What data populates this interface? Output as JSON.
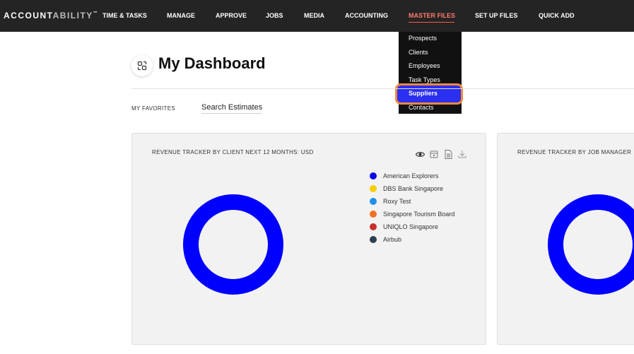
{
  "app": {
    "logo_bold": "ACCOUNT",
    "logo_light": "ABILITY",
    "logo_tm": "™"
  },
  "nav": {
    "items": [
      {
        "label": "TIME & TASKS"
      },
      {
        "label": "MANAGE"
      },
      {
        "label": "APPROVE"
      },
      {
        "label": "JOBS"
      },
      {
        "label": "MEDIA"
      },
      {
        "label": "ACCOUNTING"
      },
      {
        "label": "MASTER FILES",
        "active": true
      },
      {
        "label": "SET UP FILES"
      },
      {
        "label": "QUICK ADD"
      }
    ]
  },
  "dropdown": {
    "items": [
      {
        "label": "Prospects"
      },
      {
        "label": "Clients"
      },
      {
        "label": "Employees"
      },
      {
        "label": "Task Types"
      },
      {
        "label": "Suppliers",
        "highlighted": true
      },
      {
        "label": "Contacts"
      }
    ],
    "highlight_color": "#2b2ff0",
    "outline_color": "#f08a3e"
  },
  "page": {
    "title": "My Dashboard",
    "favorites_label": "MY FAVORITES",
    "favorite_link": "Search Estimates"
  },
  "cards": [
    {
      "title": "REVENUE TRACKER BY CLIENT NEXT 12 MONTHS: USD",
      "tools": [
        "eye-icon",
        "calendar-icon",
        "document-icon",
        "download-icon"
      ]
    },
    {
      "title": "REVENUE TRACKER BY JOB MANAGER"
    }
  ],
  "chart_data": [
    {
      "type": "pie",
      "title": "REVENUE TRACKER BY CLIENT NEXT 12 MONTHS: USD",
      "legend_position": "right",
      "categories": [
        "American Explorers",
        "DBS Bank Singapore",
        "Roxy Test",
        "Singapore Tourism Board",
        "UNIQLO Singapore",
        "Airbub"
      ],
      "colors": [
        "#0a0ae0",
        "#f5d000",
        "#1e90e8",
        "#f07020",
        "#c8302a",
        "#2c3e50"
      ],
      "values": [
        100,
        0,
        0,
        0,
        0,
        0
      ],
      "donut": true,
      "ring_color": "#0000ff"
    },
    {
      "type": "pie",
      "title": "REVENUE TRACKER BY JOB MANAGER",
      "donut": true,
      "ring_color": "#0000ff"
    }
  ]
}
